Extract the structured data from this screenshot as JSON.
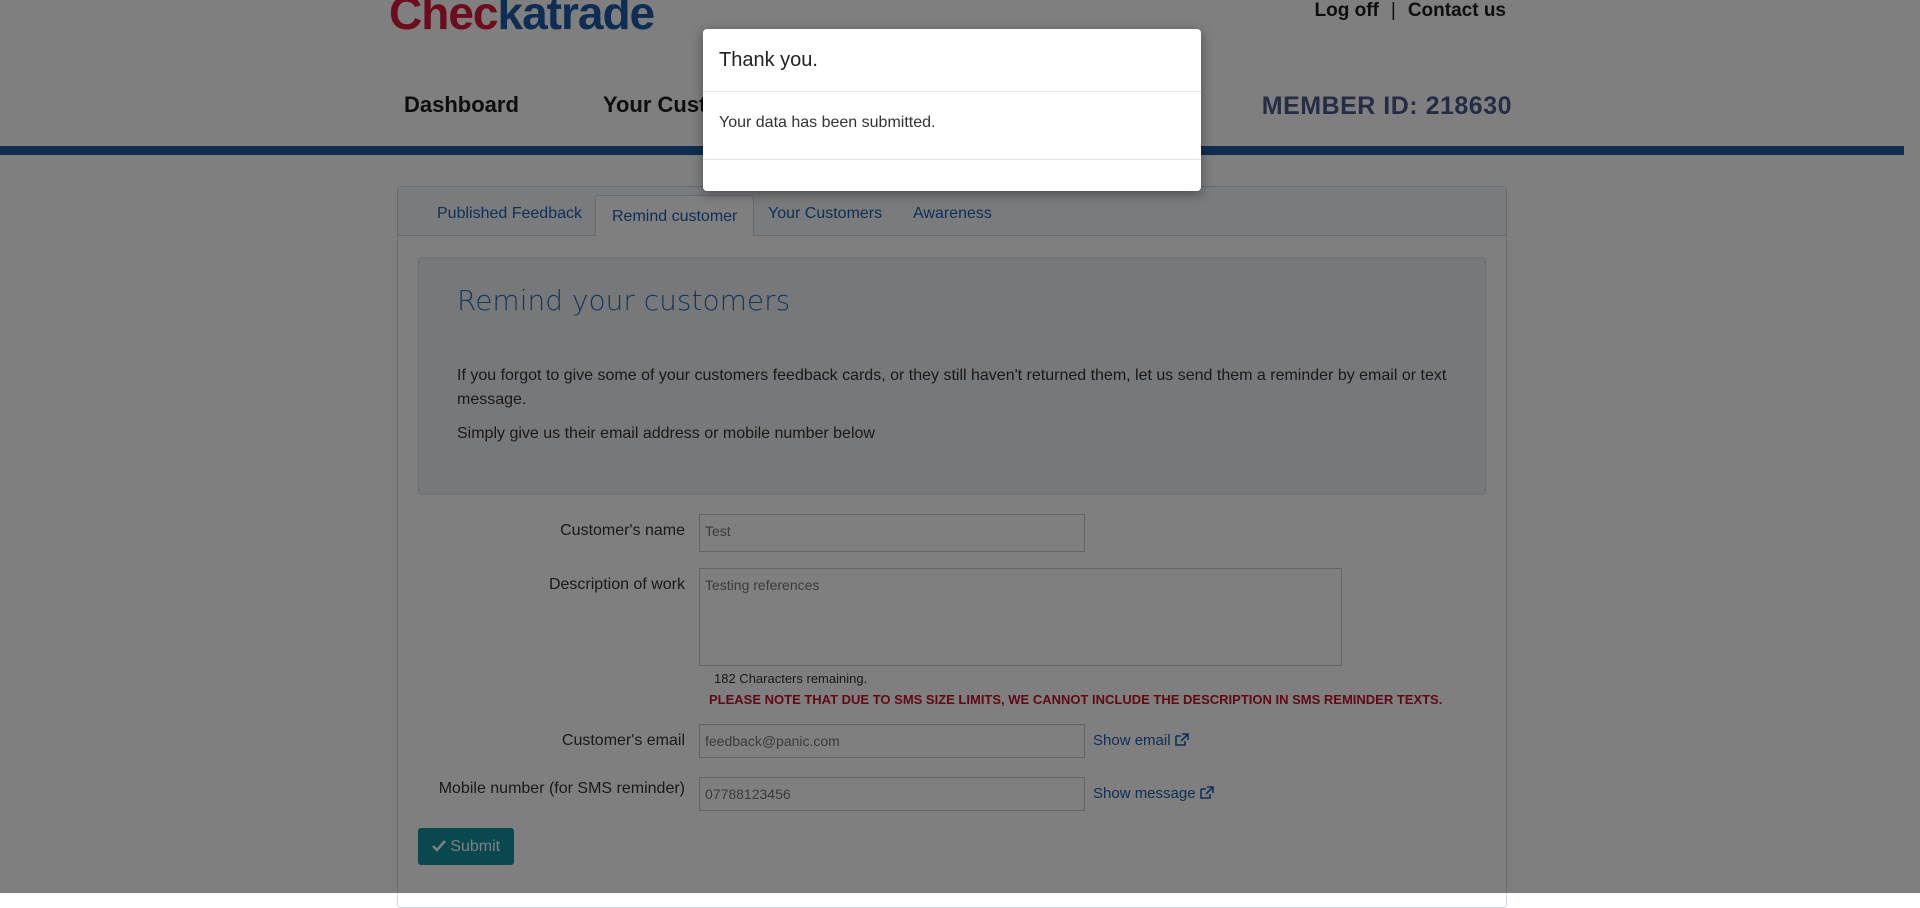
{
  "header": {
    "logo_part1": "Chec",
    "logo_part2": "katrade",
    "logoff": "Log off",
    "separator": "|",
    "contact": "Contact us",
    "nav": [
      "Dashboard",
      "Your Customers"
    ],
    "member_id": "MEMBER ID: 218630"
  },
  "tabs": [
    {
      "label": "Published Feedback",
      "active": false
    },
    {
      "label": "Remind customer",
      "active": true
    },
    {
      "label": "Your Customers",
      "active": false
    },
    {
      "label": "Awareness",
      "active": false
    }
  ],
  "intro": {
    "title": "Remind your customers",
    "p1": "If you forgot to give some of your customers feedback cards, or they still haven't returned them, let us send them a reminder by email or text message.",
    "p2": "Simply give us their email address or mobile number below"
  },
  "form": {
    "name_label": "Customer's name",
    "name_value": "Test",
    "desc_label": "Description of work",
    "desc_value": "Testing references",
    "chars_remaining": "182 Characters remaining.",
    "sms_note": "PLEASE NOTE THAT DUE TO SMS SIZE LIMITS, WE CANNOT INCLUDE THE DESCRIPTION IN SMS REMINDER TEXTS.",
    "email_label": "Customer's email",
    "email_value": "feedback@panic.com",
    "show_email": "Show email",
    "mobile_label": "Mobile number (for SMS reminder)",
    "mobile_value": "07788123456",
    "show_message": "Show message",
    "submit": "Submit"
  },
  "modal": {
    "title": "Thank you.",
    "body": "Your data has been submitted."
  },
  "colors": {
    "brand_red": "#d8183a",
    "brand_blue": "#1d5aa8",
    "link": "#1e5eb0",
    "submit_bg": "#12909e",
    "warning": "#c1122b"
  },
  "icons": {
    "submit_icon": "check-icon",
    "link_icon": "external-link-icon"
  }
}
